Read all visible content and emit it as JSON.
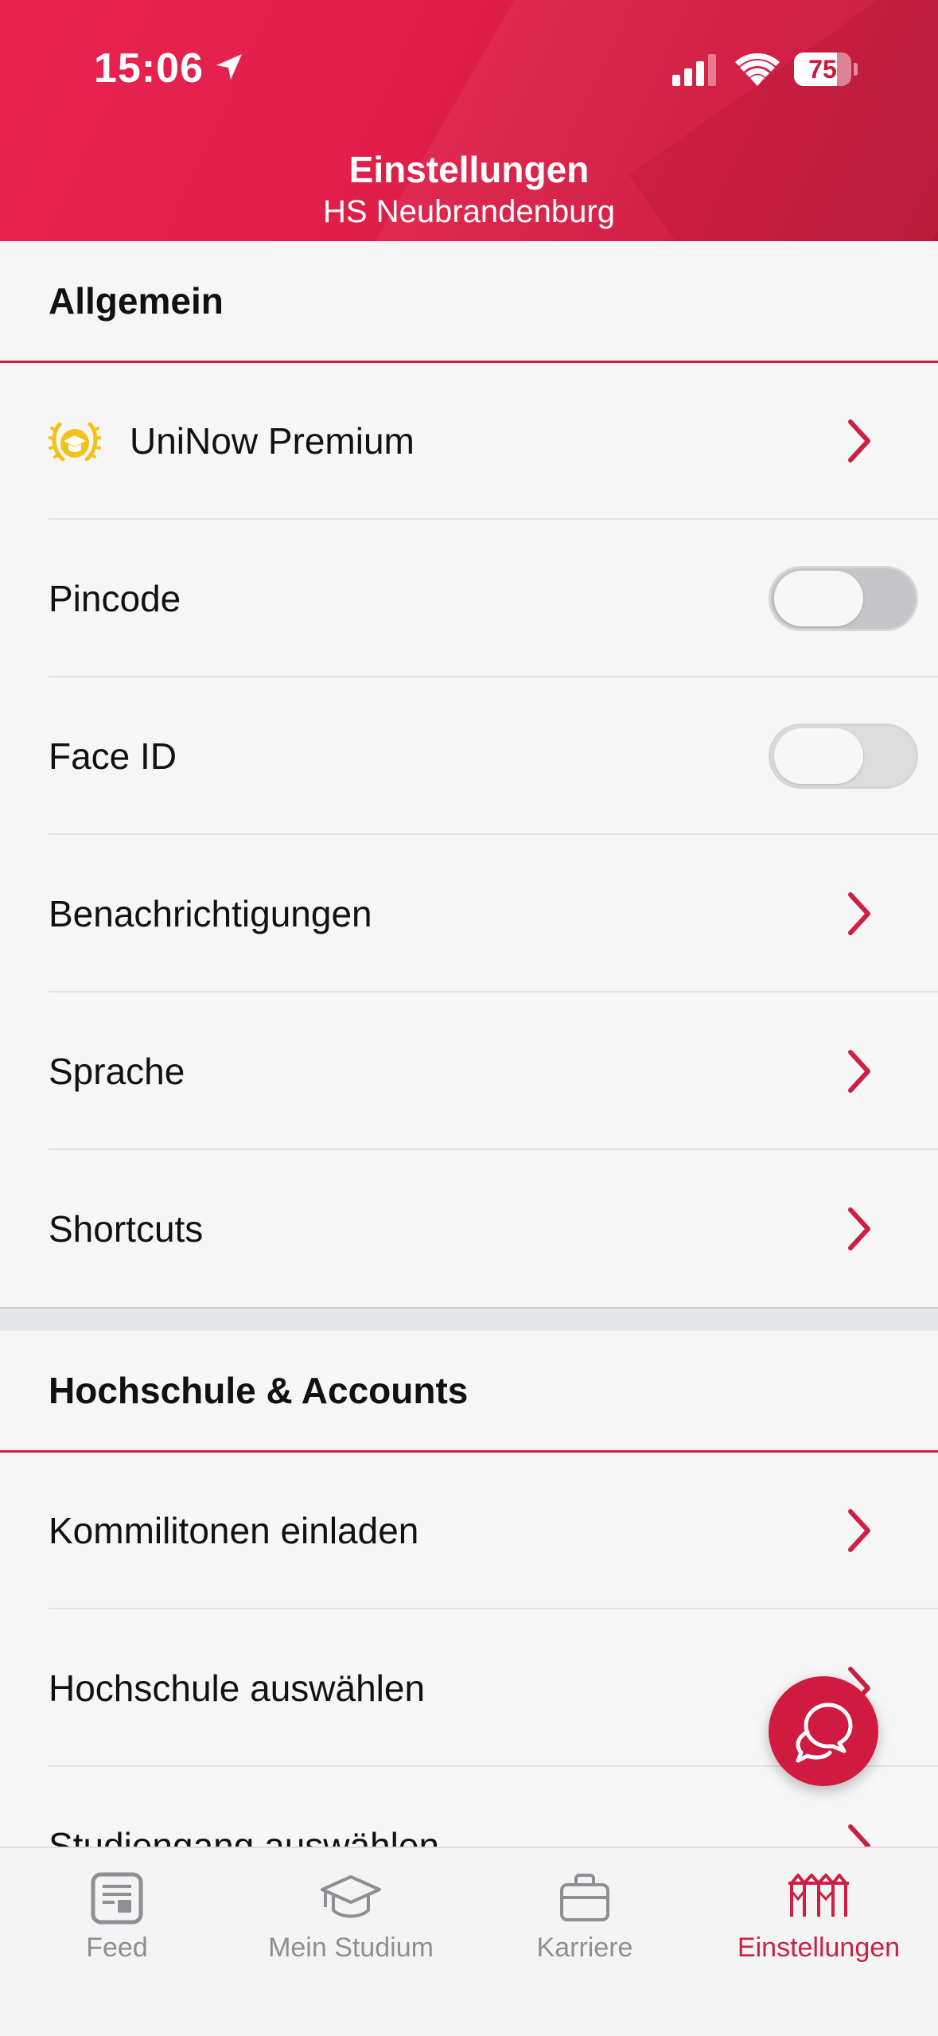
{
  "status_bar": {
    "time": "15:06",
    "battery": "75",
    "battery_level": 0.75
  },
  "header": {
    "title": "Einstellungen",
    "subtitle": "HS Neubrandenburg"
  },
  "sections": [
    {
      "title": "Allgemein",
      "items": [
        {
          "label": "UniNow Premium",
          "control": "chevron",
          "icon": "premium-badge-icon"
        },
        {
          "label": "Pincode",
          "control": "toggle",
          "state": "off"
        },
        {
          "label": "Face ID",
          "control": "toggle",
          "state": "off"
        },
        {
          "label": "Benachrichtigungen",
          "control": "chevron"
        },
        {
          "label": "Sprache",
          "control": "chevron"
        },
        {
          "label": "Shortcuts",
          "control": "chevron"
        }
      ]
    },
    {
      "title": "Hochschule & Accounts",
      "items": [
        {
          "label": "Kommilitonen einladen",
          "control": "chevron"
        },
        {
          "label": "Hochschule auswählen",
          "control": "chevron"
        },
        {
          "label": "Studiengang auswählen",
          "control": "chevron"
        }
      ]
    }
  ],
  "fab": {
    "icon": "chat-icon"
  },
  "tabbar": {
    "items": [
      {
        "label": "Feed",
        "icon": "feed-icon",
        "active": false
      },
      {
        "label": "Mein Studium",
        "icon": "graduation-cap-icon",
        "active": false
      },
      {
        "label": "Karriere",
        "icon": "briefcase-icon",
        "active": false
      },
      {
        "label": "Einstellungen",
        "icon": "settings-fence-icon",
        "active": true
      }
    ]
  },
  "colors": {
    "accent": "#cc1f44",
    "header": "#e01f48",
    "premium_gold": "#f2c21b"
  }
}
